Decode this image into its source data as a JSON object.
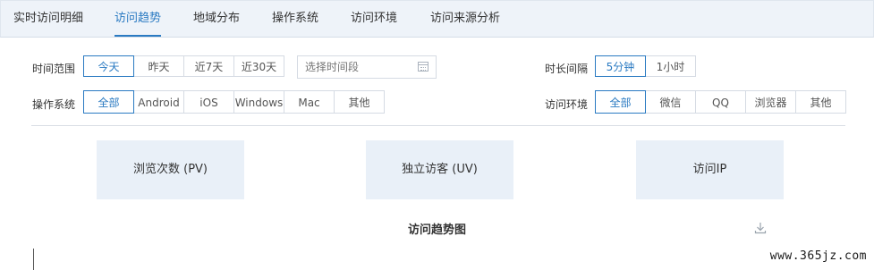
{
  "tabs": [
    {
      "label": "实时访问明细",
      "active": false
    },
    {
      "label": "访问趋势",
      "active": true
    },
    {
      "label": "地域分布",
      "active": false
    },
    {
      "label": "操作系统",
      "active": false
    },
    {
      "label": "访问环境",
      "active": false
    },
    {
      "label": "访问来源分析",
      "active": false
    }
  ],
  "time_range": {
    "label": "时间范围",
    "options": [
      "今天",
      "昨天",
      "近7天",
      "近30天"
    ],
    "selected": "今天",
    "date_placeholder": "选择时间段"
  },
  "interval": {
    "label": "时长间隔",
    "options": [
      "5分钟",
      "1小时"
    ],
    "selected": "5分钟"
  },
  "os": {
    "label": "操作系统",
    "options": [
      "全部",
      "Android",
      "iOS",
      "Windows",
      "Mac",
      "其他"
    ],
    "selected": "全部"
  },
  "env": {
    "label": "访问环境",
    "options": [
      "全部",
      "微信",
      "QQ",
      "浏览器",
      "其他"
    ],
    "selected": "全部"
  },
  "stats": [
    {
      "label": "浏览次数 (PV)"
    },
    {
      "label": "独立访客 (UV)"
    },
    {
      "label": "访问IP"
    }
  ],
  "chart": {
    "title": "访问趋势图"
  },
  "watermark": "www.365jz.com",
  "colors": {
    "accent": "#2a7ac2",
    "tab_bar": "#eef3f9",
    "card": "#e9f0f8"
  },
  "icons": {
    "download": "download-icon",
    "calendar": "calendar-icon"
  }
}
